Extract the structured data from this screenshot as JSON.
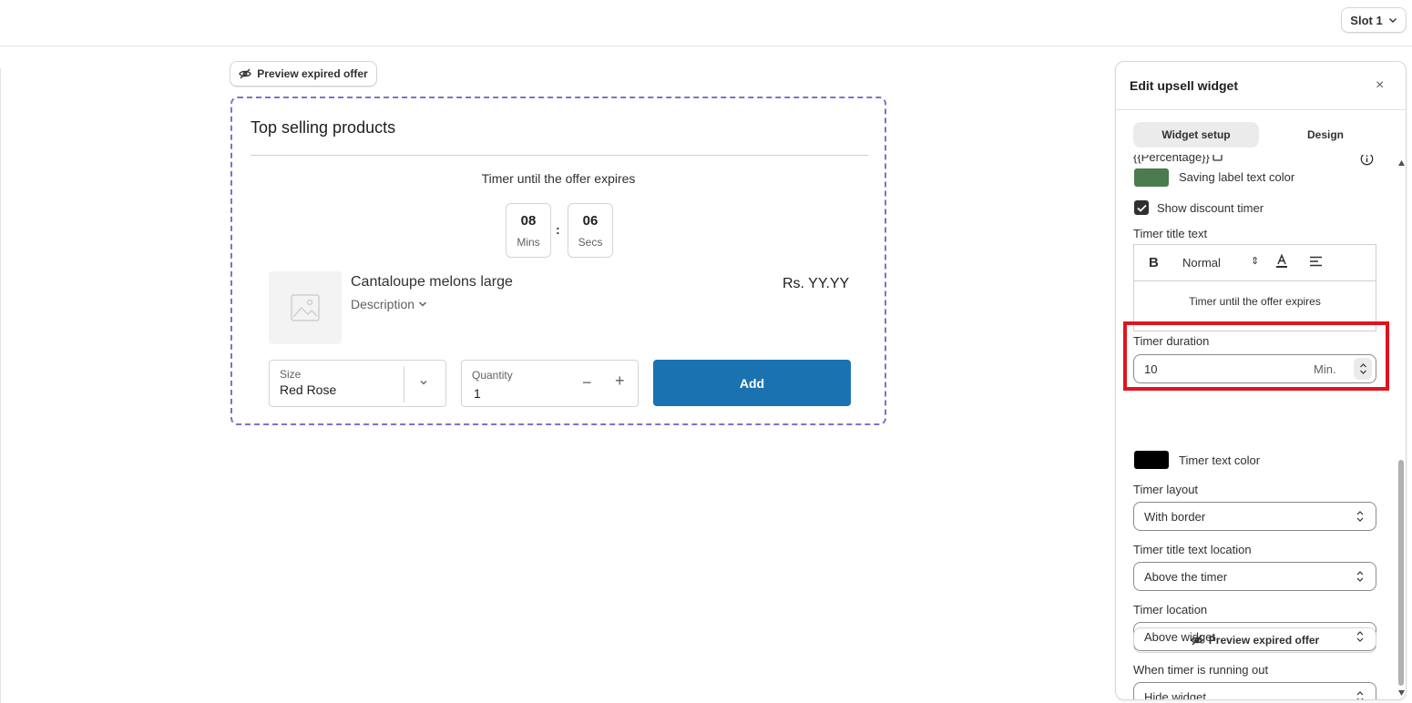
{
  "topbar": {
    "slot_label": "Slot 1"
  },
  "canvas": {
    "preview_button": "Preview expired offer",
    "widget": {
      "title": "Top selling products",
      "timer_title": "Timer until the offer expires",
      "timer": {
        "mins_value": "08",
        "mins_label": "Mins",
        "colon": ":",
        "secs_value": "06",
        "secs_label": "Secs"
      },
      "product": {
        "name": "Cantaloupe melons large",
        "description_label": "Description",
        "price": "Rs. YY.YY"
      },
      "size": {
        "label": "Size",
        "value": "Red Rose"
      },
      "quantity": {
        "label": "Quantity",
        "value": "1",
        "minus": "−",
        "plus": "+"
      },
      "add_button": "Add"
    }
  },
  "panel": {
    "title": "Edit upsell widget",
    "close": "×",
    "tabs": [
      {
        "label": "Widget setup",
        "active": true
      },
      {
        "label": "Design",
        "active": false
      }
    ],
    "percentage_token": "{{Percentage}}",
    "saving_label": {
      "text": "Saving label text color",
      "color": "#4a7c4e"
    },
    "show_discount_timer": {
      "label": "Show discount timer",
      "checked": true
    },
    "timer_title_text": {
      "label": "Timer title text",
      "toolbar_bold": "B",
      "toolbar_style": "Normal",
      "toolbar_style_arrows": "⇕",
      "content": "Timer until the offer expires"
    },
    "timer_duration": {
      "label": "Timer duration",
      "value": "10",
      "unit": "Min."
    },
    "timer_text_color": {
      "label": "Timer text color",
      "color": "#000000"
    },
    "timer_layout": {
      "label": "Timer layout",
      "value": "With border"
    },
    "timer_title_location": {
      "label": "Timer title text location",
      "value": "Above the timer"
    },
    "timer_location": {
      "label": "Timer location",
      "value": "Above widget"
    },
    "running_out": {
      "label": "When timer is running out",
      "value": "Hide widget"
    },
    "preview_button": "Preview expired offer"
  },
  "colors": {
    "add_button": "#1b72b0",
    "widget_border": "#7a73c9",
    "highlight": "#e0141e"
  }
}
